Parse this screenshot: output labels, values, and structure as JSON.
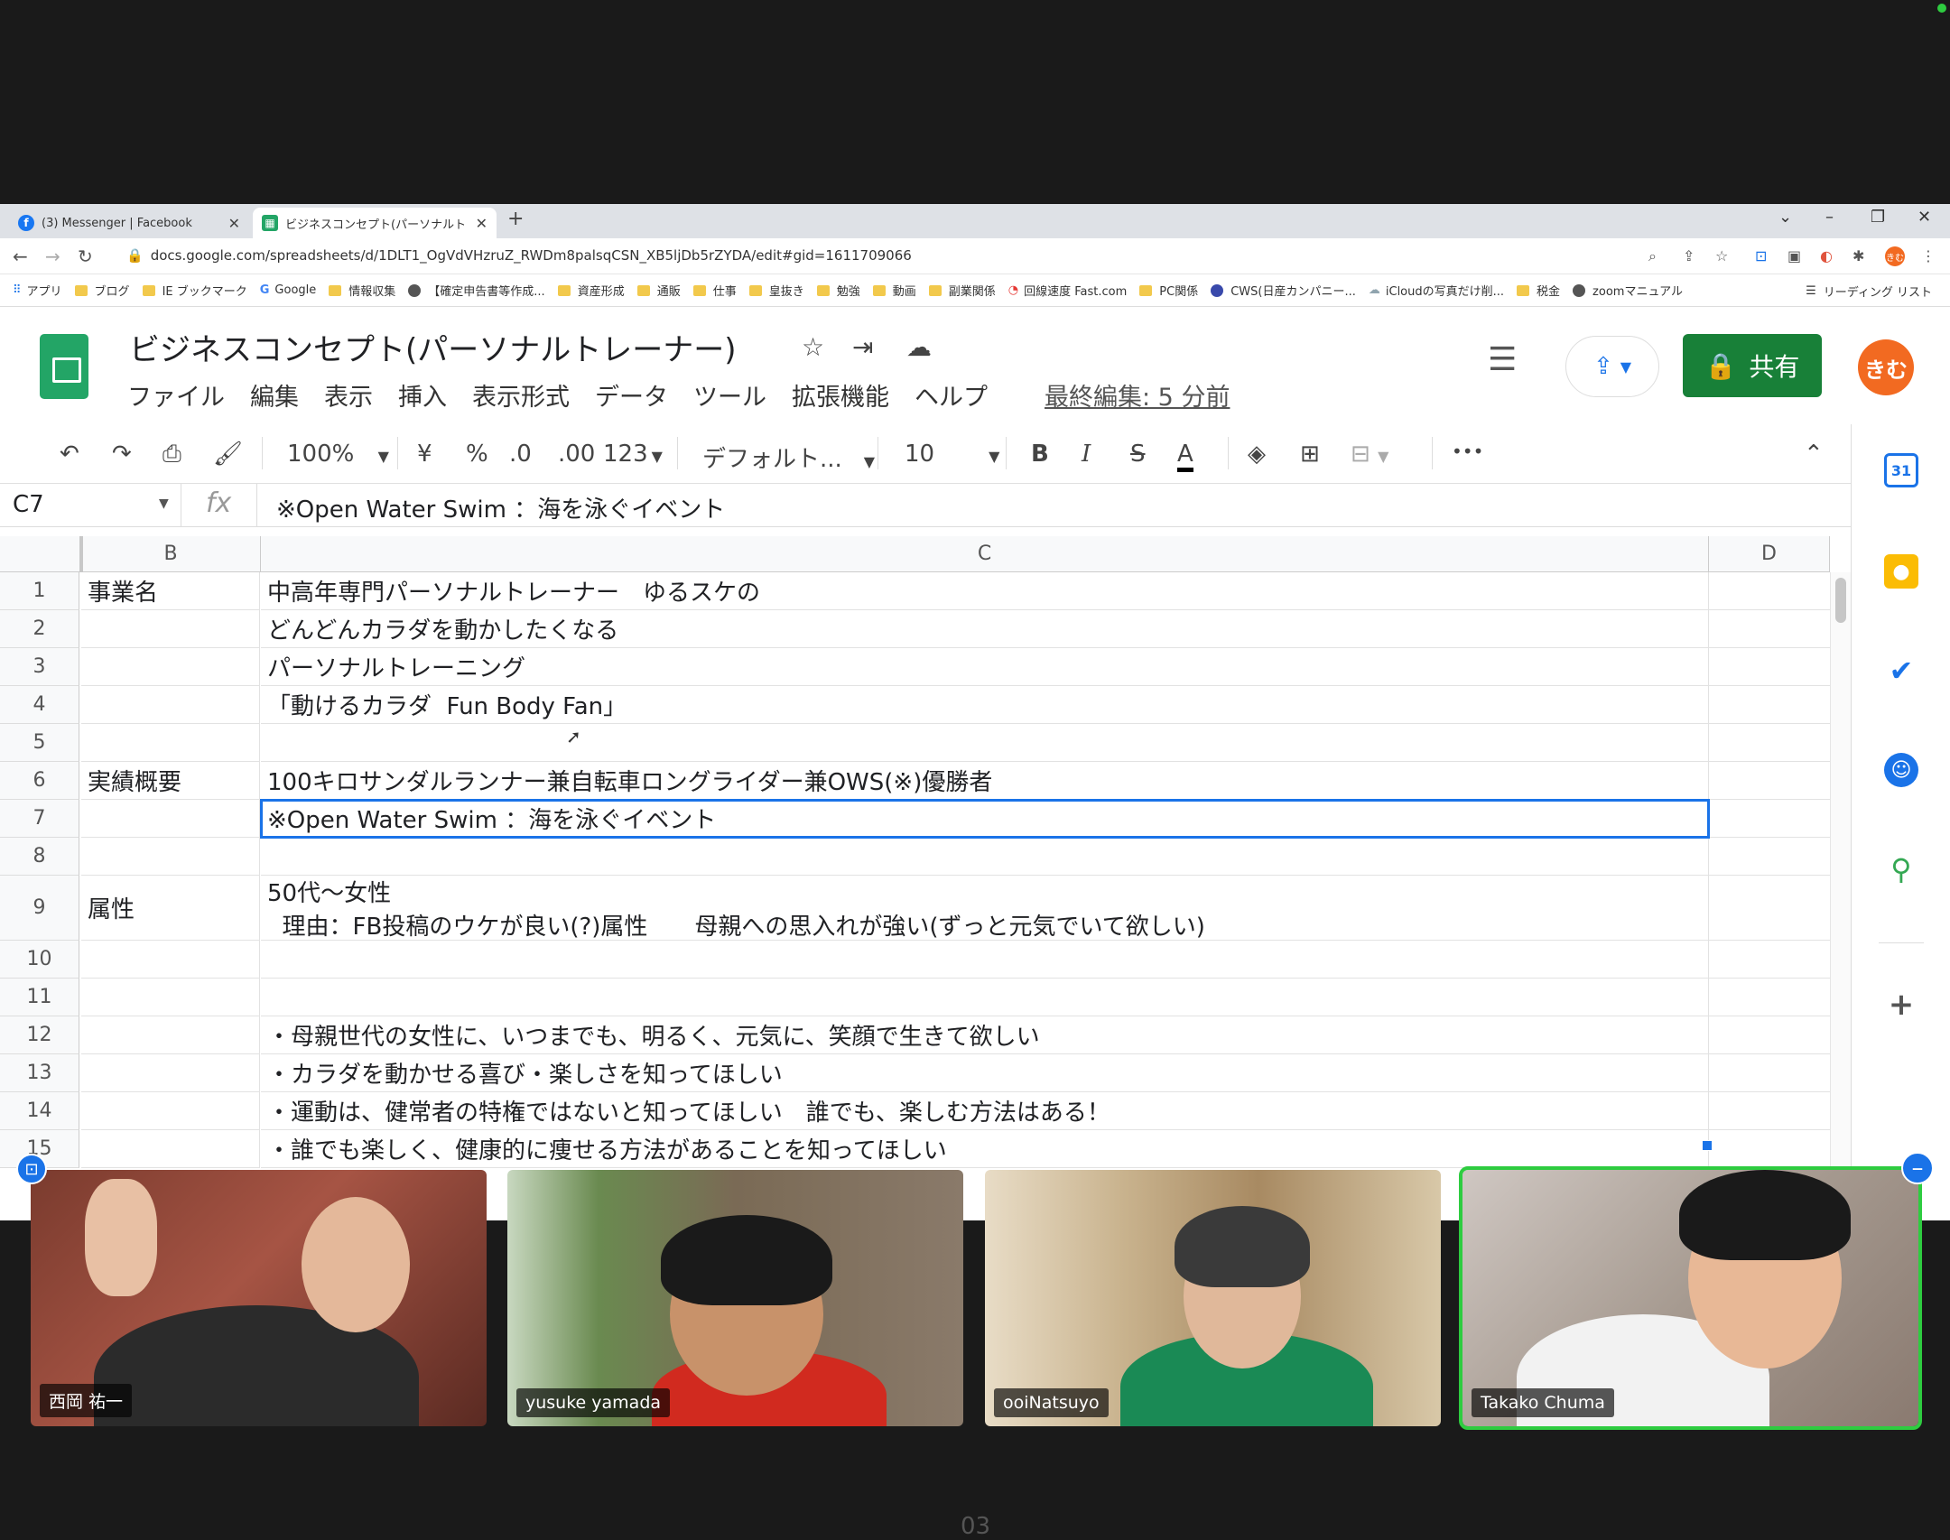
{
  "browser": {
    "tabs": [
      {
        "title": "(3) Messenger | Facebook",
        "favicon": "facebook-icon",
        "color": "#1877f2",
        "active": false
      },
      {
        "title": "ビジネスコンセプト(パーソナルトレーナ・",
        "favicon": "sheets-icon",
        "color": "#23a566",
        "active": true
      }
    ],
    "url": "docs.google.com/spreadsheets/d/1DLT1_OgVdVHzruZ_RWDm8palsqCSN_XB5ljDb5rZYDA/edit#gid=1611709066",
    "bookmarks": [
      "アプリ",
      "ブログ",
      "IE ブックマーク",
      "Google",
      "情報収集",
      "【確定申告書等作成...",
      "資産形成",
      "通販",
      "仕事",
      "皇抜き",
      "勉強",
      "動画",
      "副業関係",
      "回線速度 Fast.com",
      "PC関係",
      "CWS(日産カンパニー...",
      "iCloudの写真だけ削...",
      "税金",
      "zoomマニュアル"
    ],
    "reading_list": "リーディング リスト",
    "ext_avatar": "きむ"
  },
  "sheets": {
    "title": "ビジネスコンセプト(パーソナルトレーナー)",
    "menu": [
      "ファイル",
      "編集",
      "表示",
      "挿入",
      "表示形式",
      "データ",
      "ツール",
      "拡張機能",
      "ヘルプ"
    ],
    "last_edit": "最終編集: 5 分前",
    "share_label": "共有",
    "user_initials": "きむ",
    "toolbar": {
      "zoom": "100%",
      "currency": "¥",
      "percent": "%",
      "dec_less": ".0",
      "dec_more": ".00",
      "format_num": "123",
      "font": "デフォルト...",
      "font_size": "10",
      "bold": "B",
      "italic": "I",
      "strike": "S",
      "text_color": "A",
      "more": "•••"
    },
    "calendar_label": "31",
    "name_box": "C7",
    "fx": "fx",
    "formula": "※Open Water Swim ：海を泳ぐイベント",
    "columns": [
      "B",
      "C",
      "D"
    ],
    "rows": [
      {
        "num": "1",
        "b": "事業名",
        "c": "中高年専門パーソナルトレーナー　ゆるスケの"
      },
      {
        "num": "2",
        "b": "",
        "c": "どんどんカラダを動かしたくなる"
      },
      {
        "num": "3",
        "b": "",
        "c": "パーソナルトレーニング"
      },
      {
        "num": "4",
        "b": "",
        "c": "「動けるカラダ  Fun Body Fan」"
      },
      {
        "num": "5",
        "b": "",
        "c": ""
      },
      {
        "num": "6",
        "b": "実績概要",
        "c": "100キロサンダルランナー兼自転車ロングライダー兼OWS(※)優勝者"
      },
      {
        "num": "7",
        "b": "",
        "c": "※Open Water Swim ：海を泳ぐイベント"
      },
      {
        "num": "8",
        "b": "",
        "c": ""
      },
      {
        "num": "9",
        "b": "属性",
        "c": "50代～女性",
        "c2": "  理由：FB投稿のウケが良い(?)属性　　母親への思入れが強い(ずっと元気でいて欲しい)"
      },
      {
        "num": "10",
        "b": "",
        "c": ""
      },
      {
        "num": "11",
        "b": "",
        "c": ""
      },
      {
        "num": "12",
        "b": "",
        "c": "・母親世代の女性に、いつまでも、明るく、元気に、笑顔で生きて欲しい"
      },
      {
        "num": "13",
        "b": "",
        "c": "・カラダを動かせる喜び・楽しさを知ってほしい"
      },
      {
        "num": "14",
        "b": "",
        "c": "・運動は、健常者の特権ではないと知ってほしい　誰でも、楽しむ方法はある！"
      },
      {
        "num": "15",
        "b": "",
        "c": "・誰でも楽しく、健康的に痩せる方法があることを知ってほしい"
      }
    ],
    "peek": "03"
  },
  "zoom": {
    "participants": [
      {
        "name": "西岡 祐一",
        "active": false
      },
      {
        "name": "yusuke yamada",
        "active": false
      },
      {
        "name": "ooiNatsuyo",
        "active": false
      },
      {
        "name": "Takako Chuma",
        "active": true
      }
    ],
    "accent": "#2ecc40"
  }
}
